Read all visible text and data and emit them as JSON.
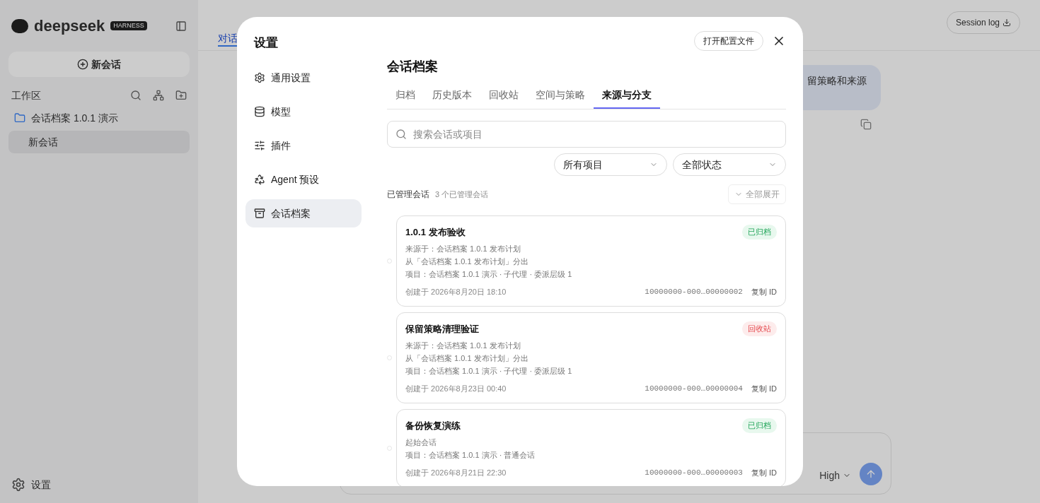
{
  "background": {
    "brand": "deepseek",
    "brand_badge": "HARNESS",
    "new_chat": "新会话",
    "workspace_label": "工作区",
    "project": "会话档案 1.0.1 演示",
    "chats": [
      {
        "label": "新会话",
        "selected": true
      }
    ],
    "settings": "设置",
    "header_tab": "对话",
    "session_log": "Session log",
    "message": "留策略和来源",
    "model_mode": "High"
  },
  "modal": {
    "title": "设置",
    "open_config": "打开配置文件",
    "nav": [
      {
        "label": "通用设置",
        "selected": false
      },
      {
        "label": "模型",
        "selected": false
      },
      {
        "label": "插件",
        "selected": false
      },
      {
        "label": "Agent 预设",
        "selected": false
      },
      {
        "label": "会话档案",
        "selected": true
      }
    ],
    "section_title": "会话档案",
    "tabs": [
      {
        "label": "归档",
        "selected": false
      },
      {
        "label": "历史版本",
        "selected": false
      },
      {
        "label": "回收站",
        "selected": false
      },
      {
        "label": "空间与策略",
        "selected": false
      },
      {
        "label": "来源与分支",
        "selected": true
      }
    ],
    "search": {
      "placeholder": "搜索会话或项目"
    },
    "filters": [
      "所有项目",
      "全部状态"
    ],
    "list_title": "已管理会话",
    "list_count": "3 个已管理会话",
    "expand_all": {
      "label": "全部展开",
      "disabled": true
    },
    "sessions": [
      {
        "title": "1.0.1 发布验收",
        "status": "已归档",
        "kind": "archived",
        "lines": [
          "来源于：会话档案 1.0.1 发布计划",
          "从「会话档案 1.0.1 发布计划」分出",
          "项目：会话档案 1.0.1 演示 · 子代理 · 委派层级 1"
        ],
        "created": "创建于 2026年8月20日 18:10",
        "id": "10000000-000…00000002",
        "copy": "复制 ID"
      },
      {
        "title": "保留策略清理验证",
        "status": "回收站",
        "kind": "trash",
        "lines": [
          "来源于：会话档案 1.0.1 发布计划",
          "从「会话档案 1.0.1 发布计划」分出",
          "项目：会话档案 1.0.1 演示 · 子代理 · 委派层级 1"
        ],
        "created": "创建于 2026年8月23日 00:40",
        "id": "10000000-000…00000004",
        "copy": "复制 ID"
      },
      {
        "title": "备份恢复演练",
        "status": "已归档",
        "kind": "archived",
        "lines": [
          "起始会话",
          "项目：会话档案 1.0.1 演示 · 普通会话"
        ],
        "created": "创建于 2026年8月21日 22:30",
        "id": "10000000-000…00000003",
        "copy": "复制 ID"
      }
    ]
  }
}
